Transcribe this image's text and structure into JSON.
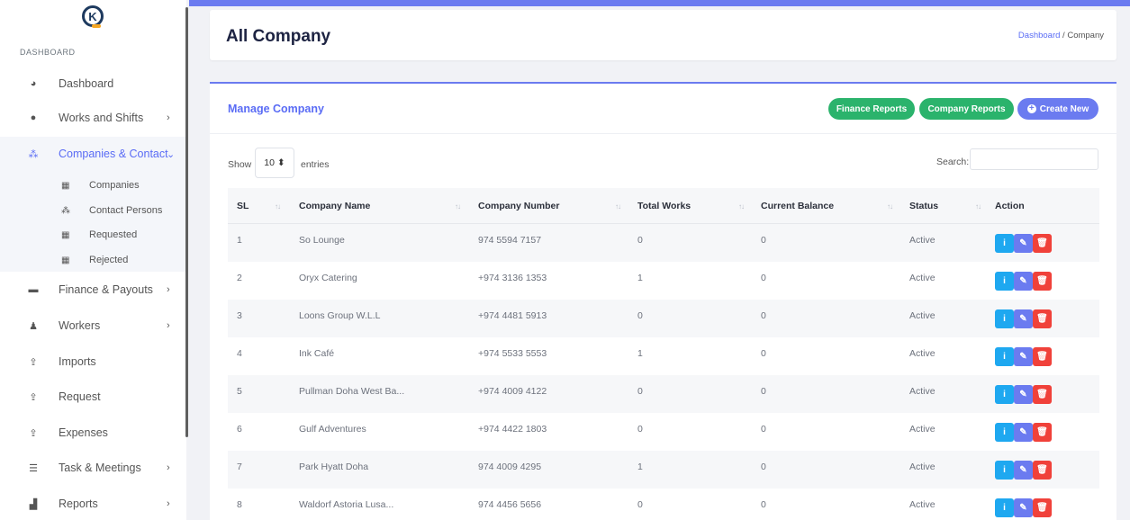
{
  "brand": {
    "logo_letter": "K"
  },
  "sidebar": {
    "section_label": "DASHBOARD",
    "items": [
      {
        "label": "Dashboard",
        "icon": "speedometer-icon"
      },
      {
        "label": "Works and Shifts",
        "icon": "clock-icon",
        "chevron": "›"
      },
      {
        "label": "Companies & Contact",
        "icon": "users-icon",
        "chevron": "⌄",
        "active": true
      },
      {
        "label": "Finance & Payouts",
        "icon": "wallet-icon",
        "chevron": "›"
      },
      {
        "label": "Workers",
        "icon": "user-check-icon",
        "chevron": "›"
      },
      {
        "label": "Imports",
        "icon": "upload-icon"
      },
      {
        "label": "Request",
        "icon": "upload-icon"
      },
      {
        "label": "Expenses",
        "icon": "upload-icon"
      },
      {
        "label": "Task & Meetings",
        "icon": "list-icon",
        "chevron": "›"
      },
      {
        "label": "Reports",
        "icon": "bar-chart-icon",
        "chevron": "›"
      }
    ],
    "sub_items": [
      {
        "label": "Companies",
        "icon": "building-icon"
      },
      {
        "label": "Contact Persons",
        "icon": "users-icon"
      },
      {
        "label": "Requested",
        "icon": "building-icon"
      },
      {
        "label": "Rejected",
        "icon": "building-icon"
      }
    ]
  },
  "header": {
    "title": "All Company",
    "breadcrumb_link": "Dashboard",
    "breadcrumb_sep": "/",
    "breadcrumb_current": "Company"
  },
  "card": {
    "title": "Manage Company",
    "buttons": {
      "finance_reports": "Finance Reports",
      "company_reports": "Company Reports",
      "create_new": "Create New",
      "create_icon": "+"
    }
  },
  "table_controls": {
    "show_label": "Show",
    "entries_value": "10 ⬍",
    "entries_label": "entries",
    "search_label": "Search:"
  },
  "table": {
    "columns": [
      "SL",
      "Company Name",
      "Company Number",
      "Total Works",
      "Current Balance",
      "Status",
      "Action"
    ],
    "sort_glyph": "↑↓",
    "rows": [
      {
        "sl": "1",
        "name": "So Lounge",
        "number": "974 5594 7157",
        "works": "0",
        "balance": "0",
        "status": "Active"
      },
      {
        "sl": "2",
        "name": "Oryx Catering",
        "number": "+974 3136 1353",
        "works": "1",
        "balance": "0",
        "status": "Active"
      },
      {
        "sl": "3",
        "name": "Loons Group W.L.L",
        "number": "+974 4481 5913",
        "works": "0",
        "balance": "0",
        "status": "Active"
      },
      {
        "sl": "4",
        "name": "Ink Café",
        "number": "+974 5533 5553",
        "works": "1",
        "balance": "0",
        "status": "Active"
      },
      {
        "sl": "5",
        "name": "Pullman Doha West Ba...",
        "number": "+974 4009 4122",
        "works": "0",
        "balance": "0",
        "status": "Active"
      },
      {
        "sl": "6",
        "name": "Gulf Adventures",
        "number": "+974 4422 1803",
        "works": "0",
        "balance": "0",
        "status": "Active"
      },
      {
        "sl": "7",
        "name": "Park Hyatt Doha",
        "number": "974 4009 4295",
        "works": "1",
        "balance": "0",
        "status": "Active"
      },
      {
        "sl": "8",
        "name": "Waldorf Astoria Lusa...",
        "number": "974 4456 5656",
        "works": "0",
        "balance": "0",
        "status": "Active"
      }
    ],
    "action_icons": {
      "info": "i",
      "edit": "✎",
      "delete": "🗑"
    }
  },
  "colors": {
    "accent": "#6b7bf0",
    "green": "#2bb36c",
    "info": "#1ea8f0",
    "danger": "#f0413a"
  }
}
